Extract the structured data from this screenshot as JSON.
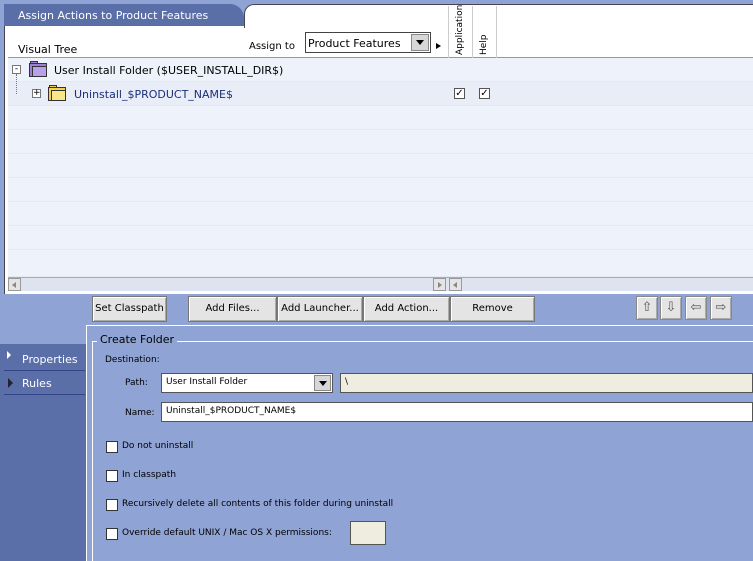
{
  "top_tab": {
    "label": "Assign Actions to Product Features"
  },
  "header": {
    "visual_tree_label": "Visual Tree",
    "assign_to_label": "Assign to",
    "assign_to_value": "Product Features",
    "columns": [
      "Application",
      "Help"
    ]
  },
  "tree": {
    "rows": [
      {
        "label": "User Install Folder ($USER_INSTALL_DIR$)",
        "expander": "-",
        "icon": "purple-folder-icon"
      },
      {
        "label": "Uninstall_$PRODUCT_NAME$",
        "expander": "+",
        "icon": "yellow-folder-icon",
        "application_checked": true,
        "help_checked": true
      }
    ]
  },
  "toolbar": {
    "set_classpath": "Set Classpath",
    "add_files": "Add Files...",
    "add_launcher": "Add Launcher...",
    "add_action": "Add Action...",
    "remove": "Remove",
    "arrows": [
      "up-arrow-icon",
      "down-arrow-icon",
      "left-arrow-icon",
      "right-arrow-icon"
    ]
  },
  "left_nav": {
    "items": [
      {
        "label": "Properties"
      },
      {
        "label": "Rules"
      }
    ]
  },
  "properties": {
    "title": "Create Folder",
    "destination_label": "Destination:",
    "path_label": "Path:",
    "path_select_value": "User Install Folder",
    "path_text_value": "\\",
    "name_label": "Name:",
    "name_value": "Uninstall_$PRODUCT_NAME$",
    "checkboxes": [
      {
        "label": "Do not uninstall",
        "checked": false
      },
      {
        "label": "In classpath",
        "checked": false
      },
      {
        "label": "Recursively delete all contents of this folder during uninstall",
        "checked": false
      },
      {
        "label": "Override default UNIX / Mac OS X permissions:",
        "checked": false
      }
    ],
    "permissions_value": ""
  },
  "colors": {
    "background": "#8fa3d4",
    "tab": "#5a6ea8",
    "tree_row": "#eef2fa"
  }
}
